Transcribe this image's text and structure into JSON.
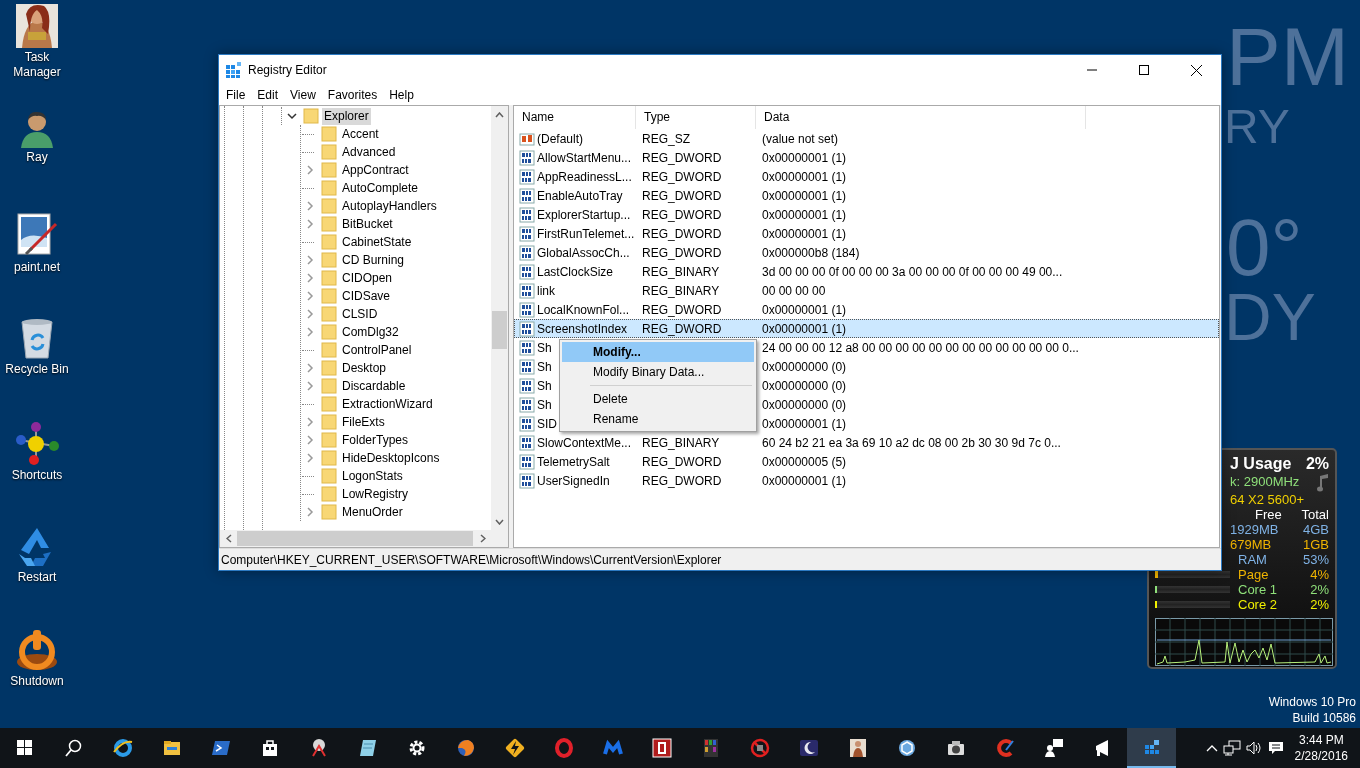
{
  "desktop_icons": [
    {
      "kind": "picture",
      "label": "Task Manager"
    },
    {
      "kind": "user",
      "label": "Ray"
    },
    {
      "kind": "paint",
      "label": "paint.net"
    },
    {
      "kind": "trash",
      "label": "Recycle Bin"
    },
    {
      "kind": "balls",
      "label": "Shortcuts"
    },
    {
      "kind": "recycle",
      "label": "Restart"
    },
    {
      "kind": "power",
      "label": "Shutdown"
    }
  ],
  "weather_widget": {
    "time": "PM",
    "day": "RY",
    "temperature": "0°",
    "condition": "DY"
  },
  "window": {
    "title": "Registry Editor",
    "menu": [
      "File",
      "Edit",
      "View",
      "Favorites",
      "Help"
    ],
    "tree": {
      "label": "Explorer",
      "expanded": true,
      "selected": true,
      "children": [
        {
          "label": "Accent",
          "expandable": false
        },
        {
          "label": "Advanced",
          "expandable": false
        },
        {
          "label": "AppContract",
          "expandable": true
        },
        {
          "label": "AutoComplete",
          "expandable": false
        },
        {
          "label": "AutoplayHandlers",
          "expandable": true
        },
        {
          "label": "BitBucket",
          "expandable": true
        },
        {
          "label": "CabinetState",
          "expandable": false
        },
        {
          "label": "CD Burning",
          "expandable": true
        },
        {
          "label": "CIDOpen",
          "expandable": true
        },
        {
          "label": "CIDSave",
          "expandable": true
        },
        {
          "label": "CLSID",
          "expandable": true
        },
        {
          "label": "ComDlg32",
          "expandable": true
        },
        {
          "label": "ControlPanel",
          "expandable": false
        },
        {
          "label": "Desktop",
          "expandable": true
        },
        {
          "label": "Discardable",
          "expandable": true
        },
        {
          "label": "ExtractionWizard",
          "expandable": false
        },
        {
          "label": "FileExts",
          "expandable": true
        },
        {
          "label": "FolderTypes",
          "expandable": true
        },
        {
          "label": "HideDesktopIcons",
          "expandable": true
        },
        {
          "label": "LogonStats",
          "expandable": false
        },
        {
          "label": "LowRegistry",
          "expandable": false
        },
        {
          "label": "MenuOrder",
          "expandable": true
        }
      ]
    },
    "columns": [
      "Name",
      "Type",
      "Data"
    ],
    "rows": [
      {
        "kind": "string",
        "name": "(Default)",
        "type": "REG_SZ",
        "data": "(value not set)",
        "selected": false
      },
      {
        "kind": "binary",
        "name": "AllowStartMenu...",
        "type": "REG_DWORD",
        "data": "0x00000001 (1)",
        "selected": false
      },
      {
        "kind": "binary",
        "name": "AppReadinessL...",
        "type": "REG_DWORD",
        "data": "0x00000001 (1)",
        "selected": false
      },
      {
        "kind": "binary",
        "name": "EnableAutoTray",
        "type": "REG_DWORD",
        "data": "0x00000001 (1)",
        "selected": false
      },
      {
        "kind": "binary",
        "name": "ExplorerStartup...",
        "type": "REG_DWORD",
        "data": "0x00000001 (1)",
        "selected": false
      },
      {
        "kind": "binary",
        "name": "FirstRunTelemet...",
        "type": "REG_DWORD",
        "data": "0x00000001 (1)",
        "selected": false
      },
      {
        "kind": "binary",
        "name": "GlobalAssocCh...",
        "type": "REG_DWORD",
        "data": "0x000000b8 (184)",
        "selected": false
      },
      {
        "kind": "binary",
        "name": "LastClockSize",
        "type": "REG_BINARY",
        "data": "3d 00 00 00 0f 00 00 00 3a 00 00 00 0f 00 00 00 49 00...",
        "selected": false
      },
      {
        "kind": "binary",
        "name": "link",
        "type": "REG_BINARY",
        "data": "00 00 00 00",
        "selected": false
      },
      {
        "kind": "binary",
        "name": "LocalKnownFol...",
        "type": "REG_DWORD",
        "data": "0x00000001 (1)",
        "selected": false
      },
      {
        "kind": "binary",
        "name": "ScreenshotIndex",
        "type": "REG_DWORD",
        "data": "0x00000001 (1)",
        "selected": true
      },
      {
        "kind": "binary",
        "name": "Sh",
        "data": "24 00 00 00 12 a8 00 00 00 00 00 00 00 00 00 00 00 00 0...",
        "selected": false
      },
      {
        "kind": "binary",
        "name": "Sh",
        "data": "0x00000000 (0)",
        "selected": false
      },
      {
        "kind": "binary",
        "name": "Sh",
        "data": "0x00000000 (0)",
        "selected": false
      },
      {
        "kind": "binary",
        "name": "Sh",
        "data": "0x00000000 (0)",
        "selected": false
      },
      {
        "kind": "binary",
        "name": "SID",
        "data": "0x00000001 (1)",
        "selected": false
      },
      {
        "kind": "binary",
        "name": "SlowContextMe...",
        "type": "REG_BINARY",
        "data": "60 24 b2 21 ea 3a 69 10 a2 dc 08 00 2b 30 30 9d 7c 0...",
        "selected": false
      },
      {
        "kind": "binary",
        "name": "TelemetrySalt",
        "type": "REG_DWORD",
        "data": "0x00000005 (5)",
        "selected": false
      },
      {
        "kind": "binary",
        "name": "UserSignedIn",
        "type": "REG_DWORD",
        "data": "0x00000001 (1)",
        "selected": false
      }
    ],
    "status_bar": "Computer\\HKEY_CURRENT_USER\\SOFTWARE\\Microsoft\\Windows\\CurrentVersion\\Explorer"
  },
  "context_menu": [
    {
      "kind": "item",
      "label": "Modify...",
      "highlighted": true
    },
    {
      "kind": "item",
      "label": "Modify Binary Data...",
      "highlighted": false
    },
    {
      "kind": "separator"
    },
    {
      "kind": "item",
      "label": "Delete",
      "highlighted": false
    },
    {
      "kind": "item",
      "label": "Rename",
      "highlighted": false
    }
  ],
  "cpu_gadget": {
    "title": "J Usage",
    "total": "2%",
    "clock": "k: 2900MHz",
    "cpu": "64 X2 5600+",
    "memory_headers": [
      "Free",
      "Total"
    ],
    "memory": [
      {
        "free": "1929MB",
        "total": "4GB",
        "color": "#7fb2e5"
      },
      {
        "free": "679MB",
        "total": "1GB",
        "color": "#f0b400"
      }
    ],
    "meters": [
      {
        "label": "RAM",
        "reading": "53%",
        "color": "#7fb2e5"
      },
      {
        "label": "Page",
        "reading": "4%",
        "level": 0.04,
        "color": "#f0b400"
      },
      {
        "label": "Core 1",
        "reading": "2%",
        "level": 0.02,
        "color": "#8fe07a"
      },
      {
        "label": "Core 2",
        "reading": "2%",
        "level": 0.02,
        "color": "#f0f000"
      }
    ]
  },
  "os_info": [
    "Windows 10 Pro",
    "Build 10586"
  ],
  "taskbar": {
    "apps": [
      {
        "selected": false
      },
      {
        "selected": false
      },
      {
        "selected": false
      },
      {
        "selected": false
      },
      {
        "selected": false
      },
      {
        "selected": false
      },
      {
        "selected": false
      },
      {
        "selected": false
      },
      {
        "selected": false
      },
      {
        "selected": false
      },
      {
        "selected": false
      },
      {
        "selected": false
      },
      {
        "selected": false
      },
      {
        "selected": false
      },
      {
        "selected": false
      },
      {
        "selected": false
      },
      {
        "selected": false
      },
      {
        "selected": false
      },
      {
        "selected": false
      },
      {
        "selected": false
      },
      {
        "selected": false
      },
      {
        "selected": true
      }
    ],
    "time": "3:44 PM",
    "date": "2/28/2016"
  }
}
